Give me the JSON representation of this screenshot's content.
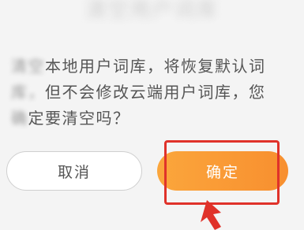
{
  "dialog": {
    "title_blurred": "清空用户词库",
    "message": {
      "line1_blurred": "清空",
      "line1": "本地用户词库，将恢复默认词",
      "line2_blurred": "库，",
      "line2": "但不会修改云端用户词库，您",
      "line3_blurred": "确",
      "line3": "定要清空吗？"
    },
    "cancel_label": "取消",
    "confirm_label": "确定"
  },
  "annotation": {
    "highlight_color": "#e0322a",
    "arrow_color": "#e0322a"
  },
  "colors": {
    "confirm_gradient_start": "#fba63c",
    "confirm_gradient_end": "#f88f2f",
    "text": "#555555"
  }
}
